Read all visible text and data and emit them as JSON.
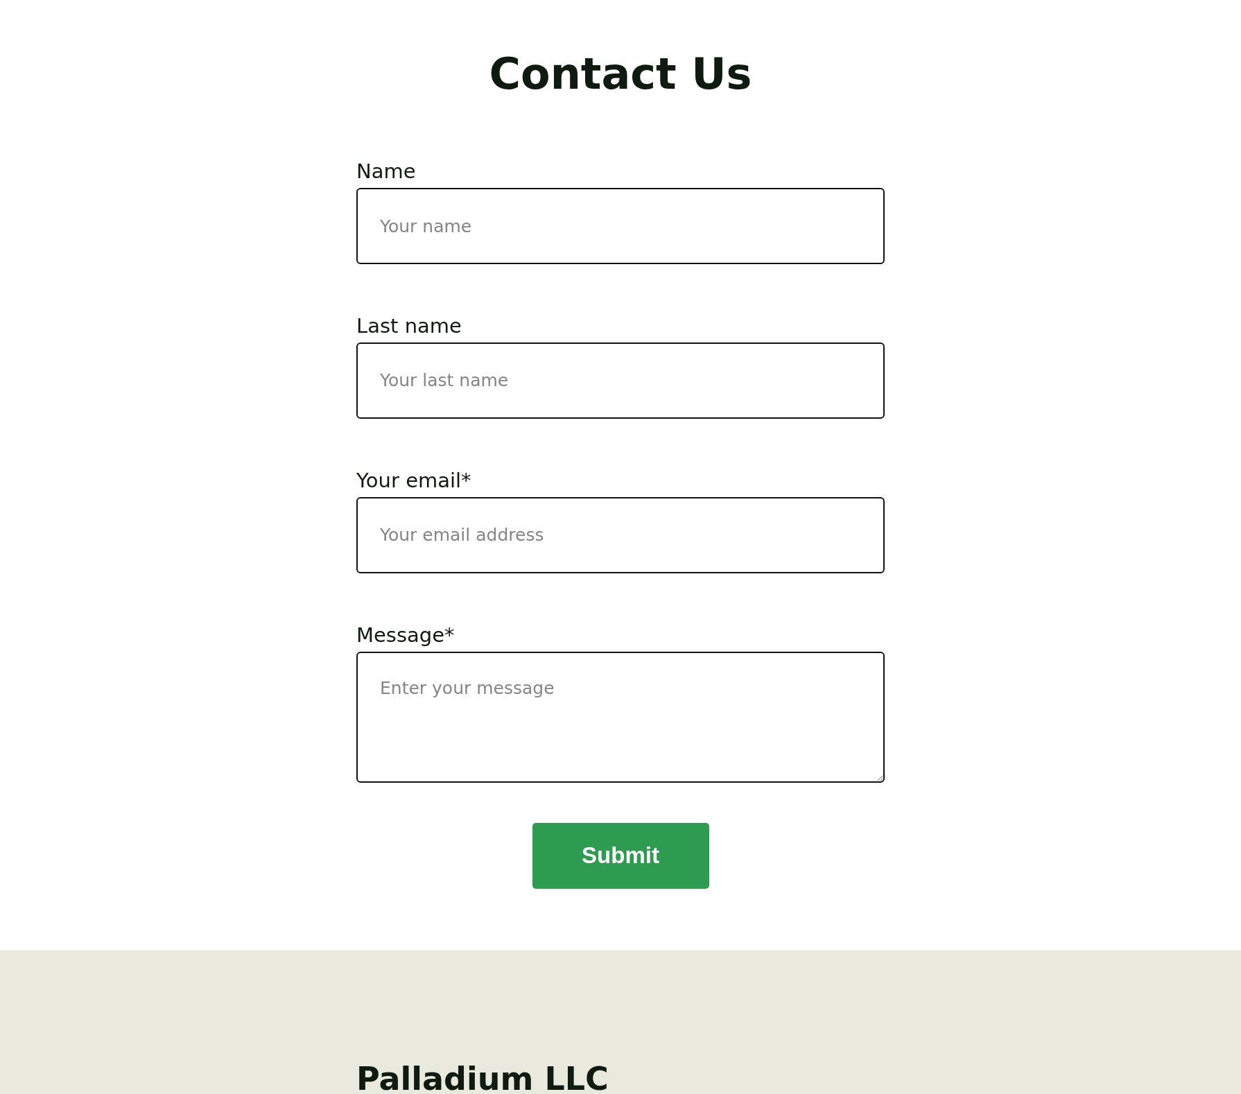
{
  "title": "Contact Us",
  "fields": [
    {
      "kind": "input",
      "label": "Name",
      "placeholder": "Your name"
    },
    {
      "kind": "input",
      "label": "Last name",
      "placeholder": "Your last name"
    },
    {
      "kind": "input",
      "label": "Your email*",
      "placeholder": "Your email address"
    },
    {
      "kind": "textarea",
      "label": "Message*",
      "placeholder": "Enter your message"
    }
  ],
  "submit": "Submit",
  "footer": {
    "company": "Palladium LLC"
  }
}
